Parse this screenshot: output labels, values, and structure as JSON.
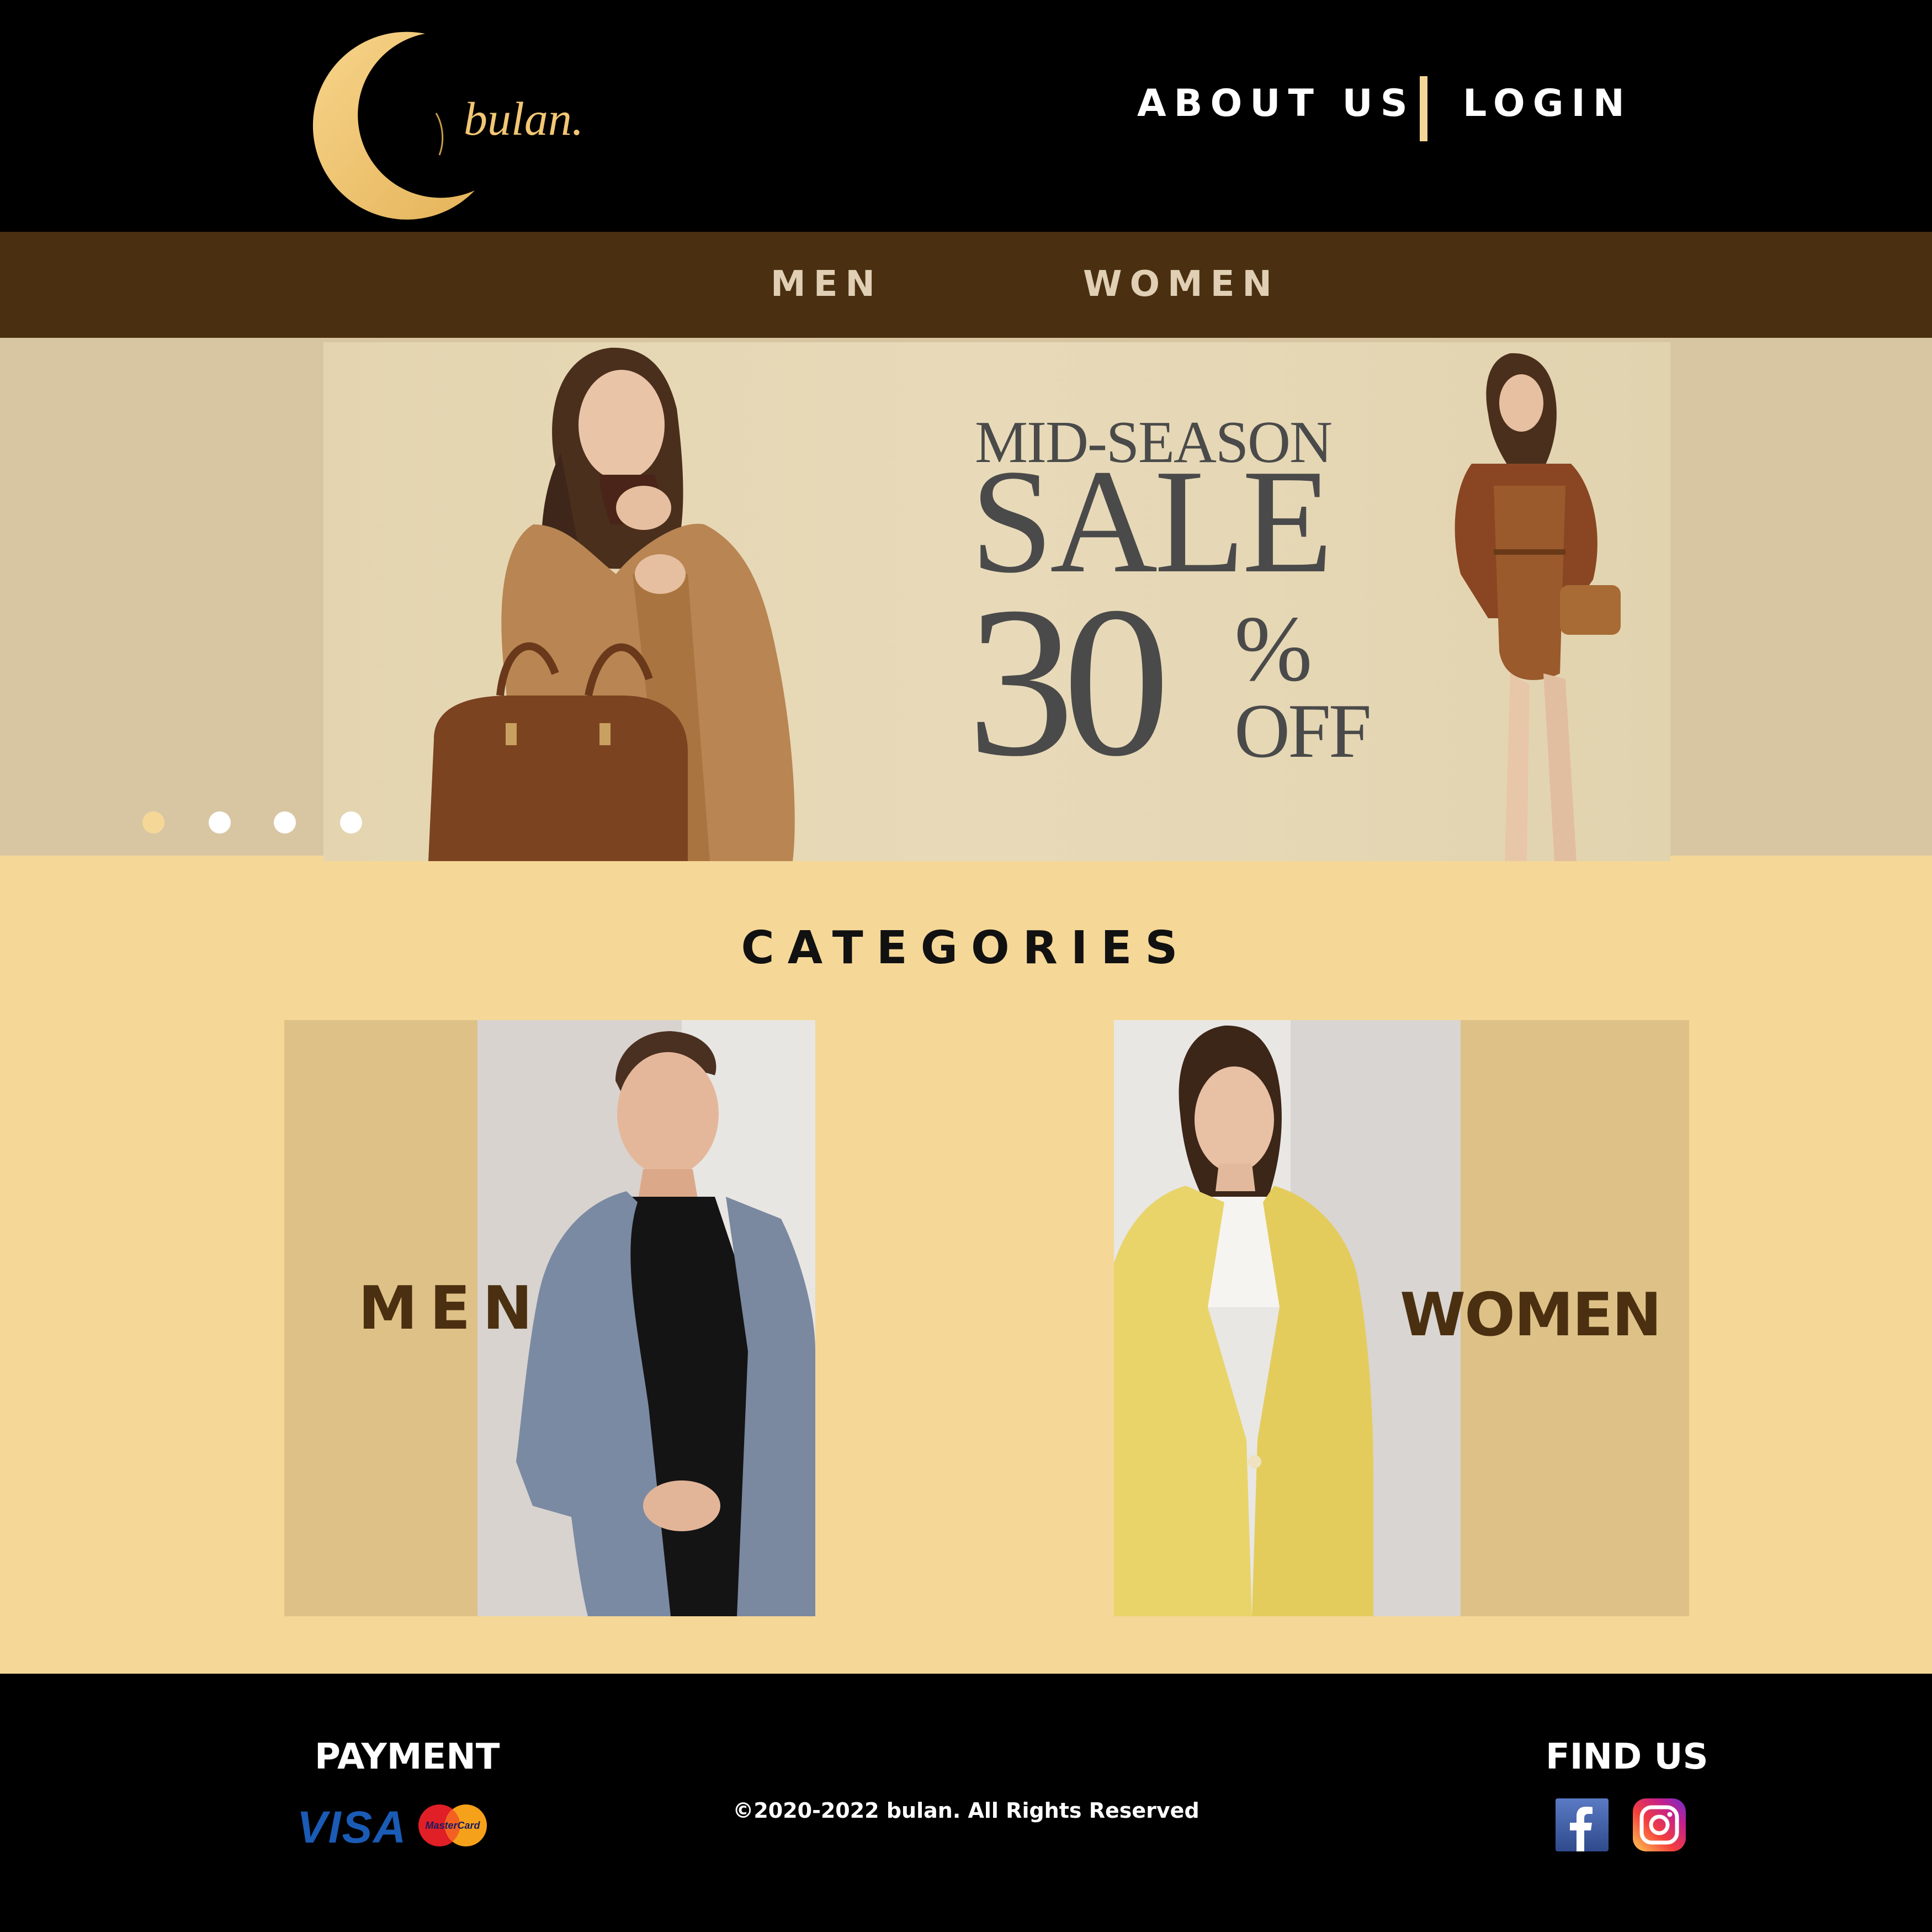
{
  "header": {
    "brand": "bulan.",
    "nav": {
      "about_label": "ABOUT US",
      "login_label": "LOGIN"
    }
  },
  "category_nav": {
    "men_label": "MEN",
    "women_label": "WOMEN"
  },
  "hero": {
    "promo_line1": "MID-SEASON",
    "promo_line2": "SALE",
    "promo_percent": "30",
    "promo_percent_sign": "%",
    "promo_off": "OFF",
    "slide_count": 4,
    "active_slide": 1
  },
  "categories": {
    "title": "CATEGORIES",
    "men_label": "MEN",
    "women_label": "WOMEN"
  },
  "footer": {
    "payment_heading": "PAYMENT",
    "payment_methods": [
      "VISA",
      "MasterCard"
    ],
    "copyright": "©2020-2022 bulan. All Rights Reserved",
    "find_us_heading": "FIND US",
    "social": [
      "facebook-icon",
      "instagram-icon"
    ]
  },
  "colors": {
    "header_bg": "#000000",
    "nav_bg": "#4a3010",
    "page_bg": "#f5d797",
    "accent_gold": "#f2c774",
    "hero_bg": "#d8c6a3"
  }
}
